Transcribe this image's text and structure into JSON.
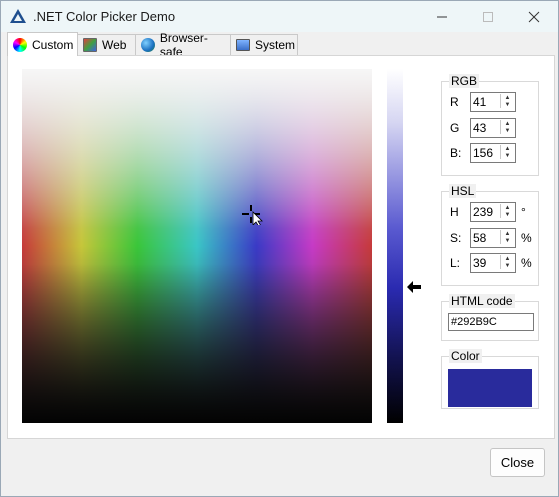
{
  "window": {
    "title": ".NET Color Picker Demo"
  },
  "tabs": [
    {
      "label": "Custom",
      "icon": "color-wheel-icon"
    },
    {
      "label": "Web",
      "icon": "web-palette-icon"
    },
    {
      "label": "Browser-safe",
      "icon": "globe-icon"
    },
    {
      "label": "System",
      "icon": "system-monitor-icon"
    }
  ],
  "rgb": {
    "title": "RGB",
    "r_label": "R",
    "g_label": "G",
    "b_label": "B:",
    "r": "41",
    "g": "43",
    "b": "156"
  },
  "hsl": {
    "title": "HSL",
    "h_label": "H",
    "s_label": "S:",
    "l_label": "L:",
    "h": "239",
    "s": "58",
    "l": "39",
    "h_unit": "°",
    "s_unit": "%",
    "l_unit": "%"
  },
  "html_code": {
    "title": "HTML code",
    "value": "#292B9C"
  },
  "color": {
    "title": "Color",
    "swatch_hex": "#292B9C"
  },
  "buttons": {
    "close": "Close"
  }
}
